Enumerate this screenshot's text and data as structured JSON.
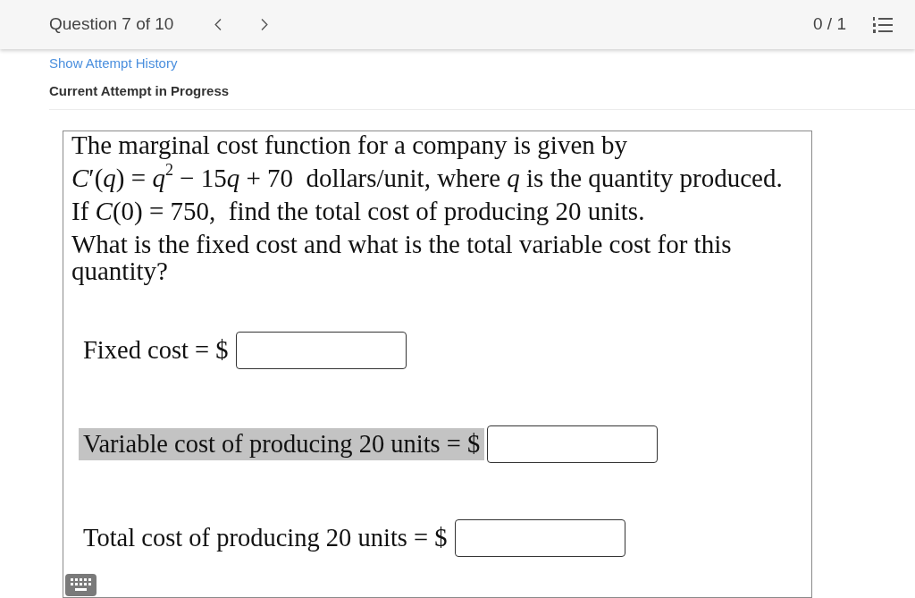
{
  "header": {
    "question_label": "Question 7 of 10",
    "score": "0 / 1"
  },
  "attempt_history_link": "Show Attempt History",
  "attempt_status": "Current Attempt in Progress",
  "problem": {
    "lines": [
      {
        "parts": [
          {
            "kind": "plain",
            "text": "The marginal cost function for a company is given by"
          }
        ]
      },
      {
        "parts": [
          {
            "kind": "var",
            "text": "C"
          },
          {
            "kind": "plain",
            "text": "′("
          },
          {
            "kind": "var",
            "text": "q"
          },
          {
            "kind": "plain",
            "text": ") = "
          },
          {
            "kind": "var",
            "text": "q"
          },
          {
            "kind": "sup",
            "text": "2"
          },
          {
            "kind": "plain",
            "text": " − 15"
          },
          {
            "kind": "var",
            "text": "q"
          },
          {
            "kind": "plain",
            "text": " + 70  dollars/unit, where "
          },
          {
            "kind": "var",
            "text": "q"
          },
          {
            "kind": "plain",
            "text": " is the quantity produced."
          }
        ]
      },
      {
        "parts": [
          {
            "kind": "plain",
            "text": "If "
          },
          {
            "kind": "var",
            "text": "C"
          },
          {
            "kind": "plain",
            "text": "(0) = 750,  find the total cost of producing 20 units."
          }
        ]
      },
      {
        "parts": [
          {
            "kind": "plain",
            "text": "What is the fixed cost and what is the total variable cost for this quantity?"
          }
        ]
      }
    ]
  },
  "answers": [
    {
      "label": "Fixed cost = $",
      "highlighted": false
    },
    {
      "label": "Variable cost of producing 20 units = $",
      "highlighted": true
    },
    {
      "label": "Total cost of producing 20 units = $",
      "highlighted": false
    }
  ]
}
